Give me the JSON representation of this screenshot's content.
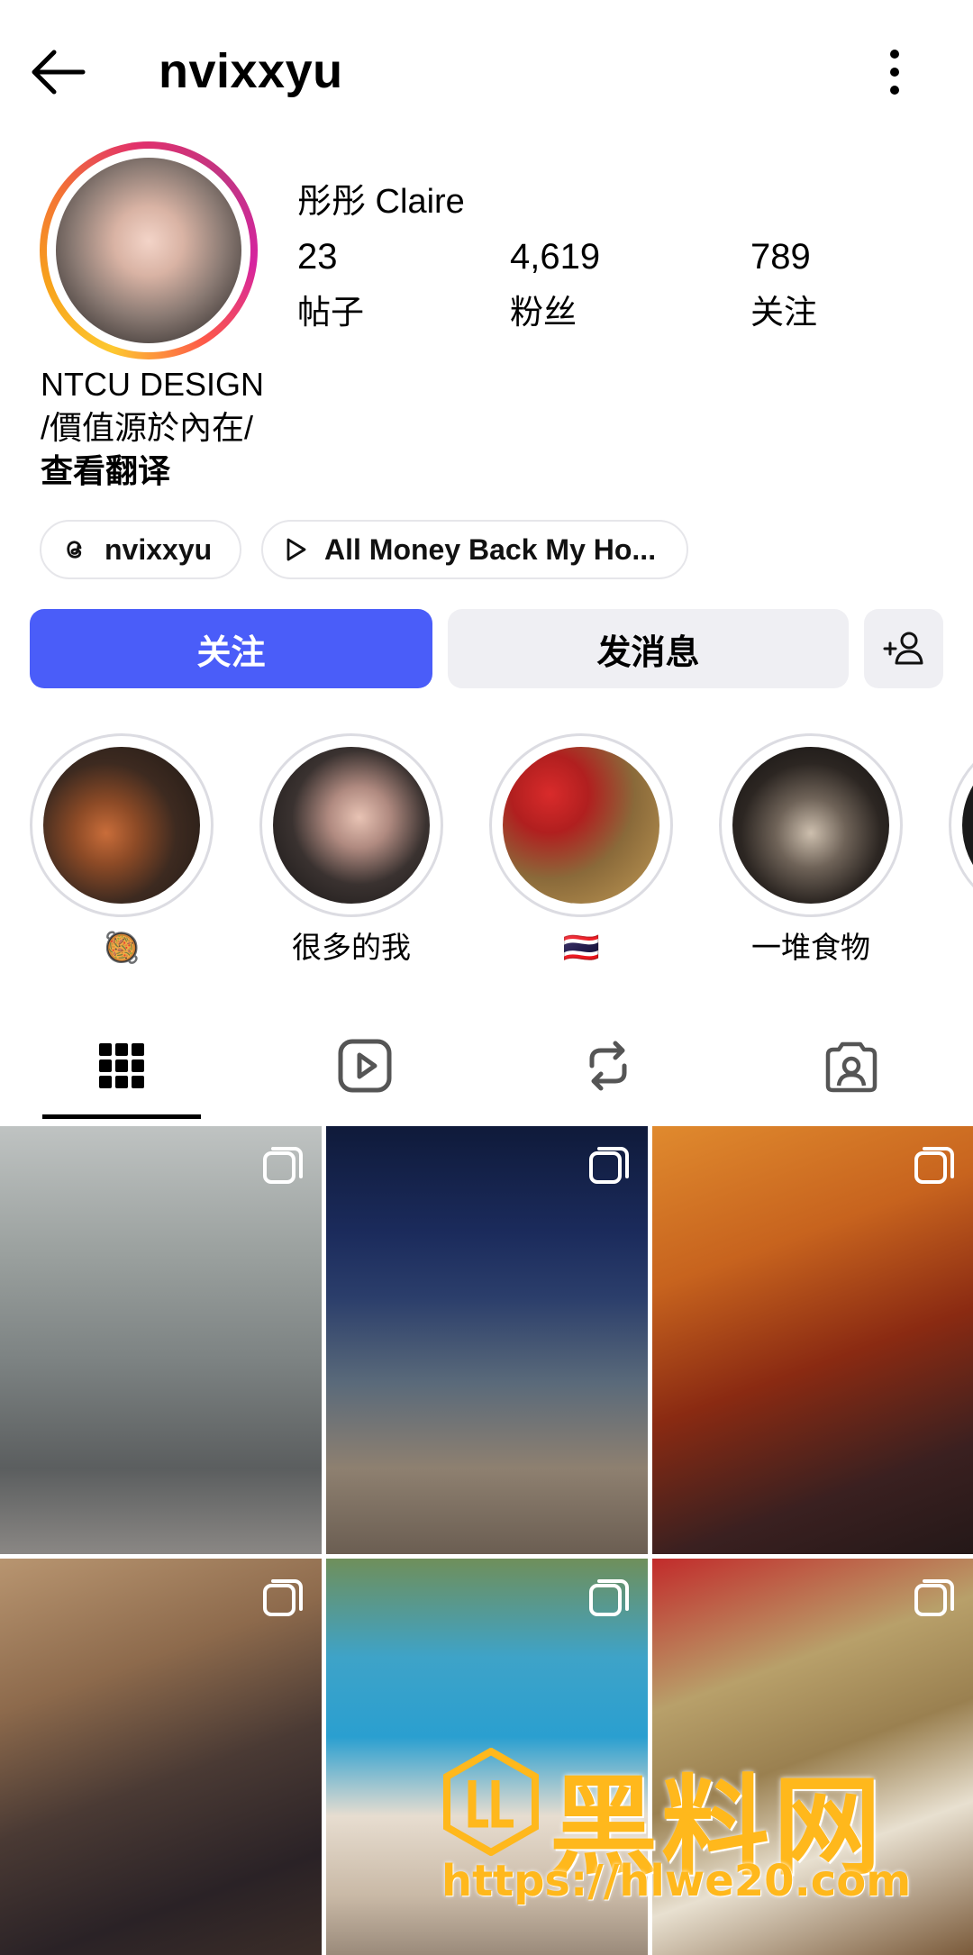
{
  "header": {
    "username": "nvixxyu"
  },
  "profile": {
    "display_name": "彤彤 Claire",
    "stats": [
      {
        "value": "23",
        "label": "帖子"
      },
      {
        "value": "4,619",
        "label": "粉丝"
      },
      {
        "value": "789",
        "label": "关注"
      }
    ],
    "bio_lines": [
      "NTCU DESIGN",
      "/價值源於內在/"
    ],
    "translate_label": "查看翻译"
  },
  "chips": {
    "threads_handle": "nvixxyu",
    "music": "All Money Back My Ho..."
  },
  "actions": {
    "follow": "关注",
    "message": "发消息"
  },
  "highlights": [
    {
      "label": "🥘"
    },
    {
      "label": "很多的我"
    },
    {
      "label": "🇹🇭"
    },
    {
      "label": "一堆食物"
    }
  ],
  "tabs": [
    "grid-icon",
    "reels-icon",
    "reposts-icon",
    "tagged-icon"
  ],
  "watermark": {
    "title": "黑料网",
    "url": "https://hlwe20.com"
  },
  "colors": {
    "accent": "#4a5df9",
    "secondary_button": "#efeff3",
    "watermark": "#ffb81c"
  }
}
